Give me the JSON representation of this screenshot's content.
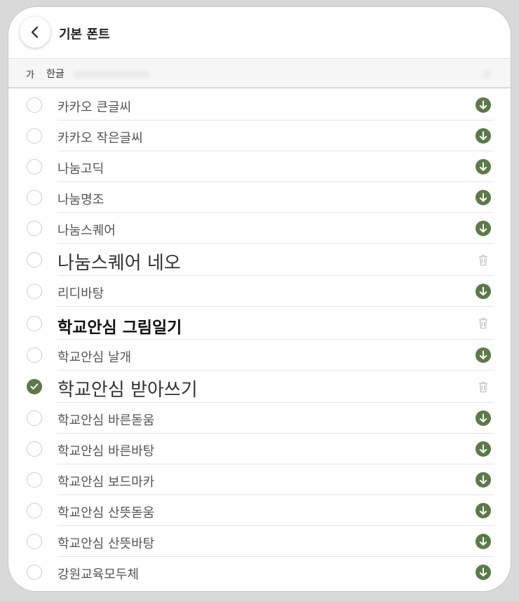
{
  "header": {
    "title": "기본 폰트"
  },
  "filter": {
    "sample": "가",
    "label": "한글"
  },
  "colors": {
    "accent": "#5b7a48",
    "trash": "#c4c4c4"
  },
  "fonts": [
    {
      "name": "카카오 큰글씨",
      "selected": false,
      "action": "download-icon",
      "style": "normal"
    },
    {
      "name": "카카오 작은글씨",
      "selected": false,
      "action": "download-icon",
      "style": "normal"
    },
    {
      "name": "나눔고딕",
      "selected": false,
      "action": "download-icon",
      "style": "normal"
    },
    {
      "name": "나눔명조",
      "selected": false,
      "action": "download-icon",
      "style": "normal"
    },
    {
      "name": "나눔스퀘어",
      "selected": false,
      "action": "download-icon",
      "style": "normal"
    },
    {
      "name": "나눔스퀘어 네오",
      "selected": false,
      "action": "trash-icon",
      "style": "big"
    },
    {
      "name": "리디바탕",
      "selected": false,
      "action": "download-icon",
      "style": "normal"
    },
    {
      "name": "학교안심 그림일기",
      "selected": false,
      "action": "trash-icon",
      "style": "bold"
    },
    {
      "name": "학교안심 날개",
      "selected": false,
      "action": "download-icon",
      "style": "normal"
    },
    {
      "name": "학교안심 받아쓰기",
      "selected": true,
      "action": "trash-icon",
      "style": "big"
    },
    {
      "name": "학교안심 바른돋움",
      "selected": false,
      "action": "download-icon",
      "style": "normal"
    },
    {
      "name": "학교안심 바른바탕",
      "selected": false,
      "action": "download-icon",
      "style": "normal"
    },
    {
      "name": "학교안심 보드마카",
      "selected": false,
      "action": "download-icon",
      "style": "normal"
    },
    {
      "name": "학교안심 산뜻돋움",
      "selected": false,
      "action": "download-icon",
      "style": "normal"
    },
    {
      "name": "학교안심 산뜻바탕",
      "selected": false,
      "action": "download-icon",
      "style": "normal"
    },
    {
      "name": "강원교육모두체",
      "selected": false,
      "action": "download-icon",
      "style": "normal"
    }
  ]
}
